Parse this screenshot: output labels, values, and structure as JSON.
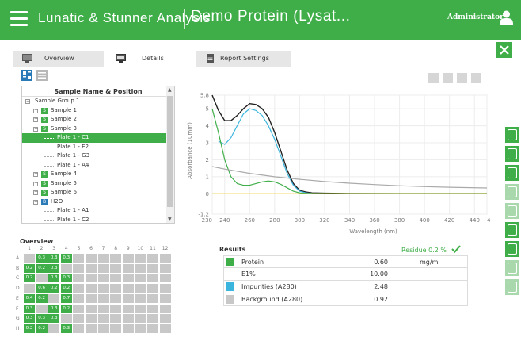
{
  "header": {
    "app_title": "Lunatic & Stunner Analysis",
    "document_title": "Demo Protein (Lysat...",
    "user": "Administrator"
  },
  "tabs": [
    {
      "label": "Overview",
      "active": false
    },
    {
      "label": "Details",
      "active": true
    },
    {
      "label": "Report Settings",
      "active": false
    }
  ],
  "tree": {
    "header": "Sample Name & Position",
    "rows": [
      {
        "indent": 0,
        "exp": "⊟",
        "badge": "",
        "label": "Sample Group 1",
        "selected": false
      },
      {
        "indent": 1,
        "exp": "⊞",
        "badge": "S",
        "label": "Sample 1",
        "selected": false
      },
      {
        "indent": 1,
        "exp": "⊞",
        "badge": "S",
        "label": "Sample 2",
        "selected": false
      },
      {
        "indent": 1,
        "exp": "⊟",
        "badge": "S",
        "label": "Sample 3",
        "selected": false
      },
      {
        "indent": 2,
        "exp": "",
        "badge": "",
        "label": "Plate 1 - C1",
        "selected": true
      },
      {
        "indent": 2,
        "exp": "",
        "badge": "",
        "label": "Plate 1 - E2",
        "selected": false
      },
      {
        "indent": 2,
        "exp": "",
        "badge": "",
        "label": "Plate 1 - G3",
        "selected": false
      },
      {
        "indent": 2,
        "exp": "",
        "badge": "",
        "label": "Plate 1 - A4",
        "selected": false
      },
      {
        "indent": 1,
        "exp": "⊞",
        "badge": "S",
        "label": "Sample 4",
        "selected": false
      },
      {
        "indent": 1,
        "exp": "⊞",
        "badge": "S",
        "label": "Sample 5",
        "selected": false
      },
      {
        "indent": 1,
        "exp": "⊞",
        "badge": "S",
        "label": "Sample 6",
        "selected": false
      },
      {
        "indent": 1,
        "exp": "⊟",
        "badge": "B",
        "label": "H2O",
        "selected": false
      },
      {
        "indent": 2,
        "exp": "",
        "badge": "",
        "label": "Plate 1 - A1",
        "selected": false
      },
      {
        "indent": 2,
        "exp": "",
        "badge": "",
        "label": "Plate 1 - C2",
        "selected": false
      }
    ]
  },
  "overview": {
    "title": "Overview",
    "columns": [
      "1",
      "2",
      "3",
      "4",
      "5",
      "6",
      "7",
      "8",
      "9",
      "10",
      "11",
      "12"
    ],
    "rows": [
      "A",
      "B",
      "C",
      "D",
      "E",
      "F",
      "G",
      "H"
    ],
    "wells": [
      [
        "",
        "0.3",
        "0.3",
        "0.3",
        "",
        "",
        "",
        "",
        "",
        "",
        "",
        ""
      ],
      [
        "0.2",
        "0.2",
        "0.3",
        "",
        "",
        "",
        "",
        "",
        "",
        "",
        "",
        ""
      ],
      [
        "0.2",
        "",
        "0.3",
        "0.3",
        "",
        "",
        "",
        "",
        "",
        "",
        "",
        ""
      ],
      [
        "",
        "0.6",
        "0.2",
        "0.2",
        "",
        "",
        "",
        "",
        "",
        "",
        "",
        ""
      ],
      [
        "0.4",
        "0.2",
        "",
        "0.7",
        "",
        "",
        "",
        "",
        "",
        "",
        "",
        ""
      ],
      [
        "0.3",
        "",
        "0.3",
        "0.2",
        "",
        "",
        "",
        "",
        "",
        "",
        "",
        ""
      ],
      [
        "0.3",
        "0.3",
        "0.3",
        "",
        "",
        "",
        "",
        "",
        "",
        "",
        "",
        ""
      ],
      [
        "0.2",
        "0.2",
        "",
        "0.3",
        "",
        "",
        "",
        "",
        "",
        "",
        "",
        ""
      ]
    ],
    "filled_wells": [
      [
        false,
        true,
        true,
        true,
        false,
        false,
        false,
        false,
        false,
        false,
        false,
        false
      ],
      [
        true,
        true,
        true,
        false,
        false,
        false,
        false,
        false,
        false,
        false,
        false,
        false
      ],
      [
        true,
        false,
        true,
        true,
        false,
        false,
        false,
        false,
        false,
        false,
        false,
        false
      ],
      [
        false,
        true,
        true,
        true,
        false,
        false,
        false,
        false,
        false,
        false,
        false,
        false
      ],
      [
        true,
        true,
        false,
        true,
        false,
        false,
        false,
        false,
        false,
        false,
        false,
        false
      ],
      [
        true,
        false,
        true,
        true,
        false,
        false,
        false,
        false,
        false,
        false,
        false,
        false
      ],
      [
        true,
        true,
        true,
        false,
        false,
        false,
        false,
        false,
        false,
        false,
        false,
        false
      ],
      [
        true,
        true,
        false,
        true,
        false,
        false,
        false,
        false,
        false,
        false,
        false,
        false
      ]
    ],
    "well_color": "#3fae49",
    "empty_color": "#c8c8c8"
  },
  "chart_data": {
    "type": "line",
    "ylabel": "Absorbance (10mm)",
    "xlabel": "Wavelength (nm)",
    "xlim": [
      230,
      450
    ],
    "ylim": [
      -1.2,
      5.8
    ],
    "x_ticks": [
      "230",
      "240",
      "260",
      "280",
      "300",
      "320",
      "340",
      "360",
      "380",
      "400",
      "420",
      "440",
      "450"
    ],
    "x_tick_values": [
      230,
      240,
      260,
      280,
      300,
      320,
      340,
      360,
      380,
      400,
      420,
      440,
      450
    ],
    "y_ticks": [
      "-1.2",
      "0",
      "1",
      "2",
      "3",
      "4",
      "5",
      "5.8"
    ],
    "y_tick_values": [
      -1.2,
      0,
      1,
      2,
      3,
      4,
      5,
      5.8
    ],
    "grid": true,
    "series": [
      {
        "color": "#222222",
        "x": [
          230,
          235,
          240,
          245,
          250,
          255,
          260,
          265,
          270,
          275,
          280,
          285,
          290,
          295,
          300,
          305,
          310,
          320,
          340,
          380,
          420,
          450
        ],
        "y": [
          5.8,
          4.9,
          4.3,
          4.3,
          4.6,
          5.0,
          5.3,
          5.25,
          5.0,
          4.5,
          3.6,
          2.5,
          1.4,
          0.6,
          0.2,
          0.1,
          0.05,
          0.03,
          0.02,
          0.01,
          0.01,
          0.01
        ]
      },
      {
        "color": "#3bb5dd",
        "x": [
          235,
          240,
          245,
          250,
          255,
          260,
          265,
          270,
          275,
          280,
          285,
          290,
          295,
          300,
          305,
          310,
          320,
          350,
          450
        ],
        "y": [
          3.1,
          2.9,
          3.3,
          4.0,
          4.7,
          5.0,
          4.9,
          4.6,
          4.0,
          3.2,
          2.2,
          1.2,
          0.5,
          0.15,
          0.05,
          0.02,
          0.01,
          0.01,
          0.01
        ]
      },
      {
        "color": "#3fae49",
        "x": [
          230,
          235,
          240,
          245,
          250,
          255,
          260,
          265,
          270,
          275,
          280,
          285,
          290,
          295,
          300,
          305,
          310,
          320,
          350,
          450
        ],
        "y": [
          5.0,
          3.6,
          2.0,
          1.0,
          0.6,
          0.5,
          0.5,
          0.6,
          0.7,
          0.75,
          0.7,
          0.55,
          0.35,
          0.15,
          0.05,
          0.02,
          0.01,
          0.01,
          0.01,
          0.01
        ]
      },
      {
        "color": "#aaaaaa",
        "x": [
          230,
          240,
          260,
          280,
          300,
          320,
          340,
          360,
          380,
          400,
          420,
          450
        ],
        "y": [
          1.6,
          1.45,
          1.2,
          1.0,
          0.85,
          0.72,
          0.62,
          0.54,
          0.47,
          0.42,
          0.38,
          0.34
        ]
      },
      {
        "color": "#f2c200",
        "x": [
          230,
          450
        ],
        "y": [
          0,
          0
        ]
      }
    ]
  },
  "results": {
    "title": "Results",
    "residue": "Residue 0.2 %",
    "rows": [
      {
        "name": "Protein",
        "value": "0.60",
        "unit": "mg/ml",
        "color": "#3fae49"
      },
      {
        "name": "E1%",
        "value": "10.00",
        "unit": "",
        "color": ""
      },
      {
        "name": "Impurities (A280)",
        "value": "2.48",
        "unit": "",
        "color": "#3bb5dd"
      },
      {
        "name": "Background (A280)",
        "value": "0.92",
        "unit": "",
        "color": "#c8c8c8"
      }
    ]
  },
  "side_buttons": [
    {
      "icon": "info-icon",
      "enabled": true
    },
    {
      "icon": "chart-icon",
      "enabled": true
    },
    {
      "icon": "report-icon",
      "enabled": true
    },
    {
      "icon": "save-icon",
      "enabled": false
    },
    {
      "icon": "keyboard-icon",
      "enabled": false
    },
    {
      "icon": "edit-icon",
      "enabled": true
    },
    {
      "icon": "wrench-icon",
      "enabled": true
    },
    {
      "icon": "search-document-icon",
      "enabled": false
    },
    {
      "icon": "blank-document-icon",
      "enabled": false
    }
  ]
}
